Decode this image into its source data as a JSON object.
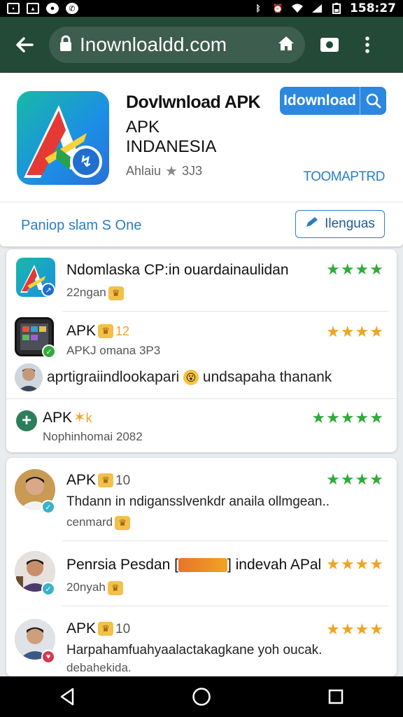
{
  "status_bar": {
    "left_icons": [
      "notification-icon",
      "gallery-icon",
      "messenger-icon",
      "whatsapp-icon"
    ],
    "right_icons": [
      "bluetooth-icon",
      "alarm-icon",
      "wifi-icon",
      "signal-icon",
      "battery-icon"
    ],
    "time": "158:27"
  },
  "toolbar": {
    "url": "Inownloaldd.com",
    "accent": "#234a37"
  },
  "app": {
    "title_line1": "Dovlwnload APK",
    "title_line2": "APK",
    "title_line3": "INDANESIA",
    "rating_label": "Ahlaiu",
    "rating_value": "3J3",
    "download_label": "Idownload",
    "status_tag": "TOOMAPTRD",
    "panel_text": "Paniop slam S One",
    "language_button": "Ilenguas"
  },
  "feed1": [
    {
      "title": "Ndomlaska CP:in ouardainaulidan",
      "sub": "22ngan",
      "stars": 4,
      "star_color": "green"
    },
    {
      "title": "APK",
      "title_badge": "12",
      "sub": "APKJ omana 3P3",
      "stars": 4,
      "star_color": "orange"
    },
    {
      "comment": "aprtigraiindlookapari",
      "comment_tail": "undsapaha thanank"
    },
    {
      "title": "APK",
      "title_badge": "k",
      "sub": "Nophinhomai 2082",
      "stars": 5,
      "star_color": "green"
    }
  ],
  "feed2": [
    {
      "title": "APK",
      "title_badge": "10",
      "body": "Thdann in ndigansslvenkdr anaila ollmgean..",
      "sub": "cenmard",
      "stars": 4,
      "star_color": "green"
    },
    {
      "title": "Penrsia Pesdan",
      "title_tail": "indevah APal",
      "sub": "20nyah",
      "stars": 4,
      "star_color": "orange"
    },
    {
      "title": "APK",
      "title_badge": "10",
      "body": "Harpahamfuahyaalactakagkane yoh oucak.",
      "body2": "debahekida.",
      "stars": 4,
      "star_color": "orange"
    }
  ],
  "colors": {
    "accent_blue": "#2c87e0",
    "star_green": "#2fab3b",
    "star_orange": "#f0a423"
  }
}
